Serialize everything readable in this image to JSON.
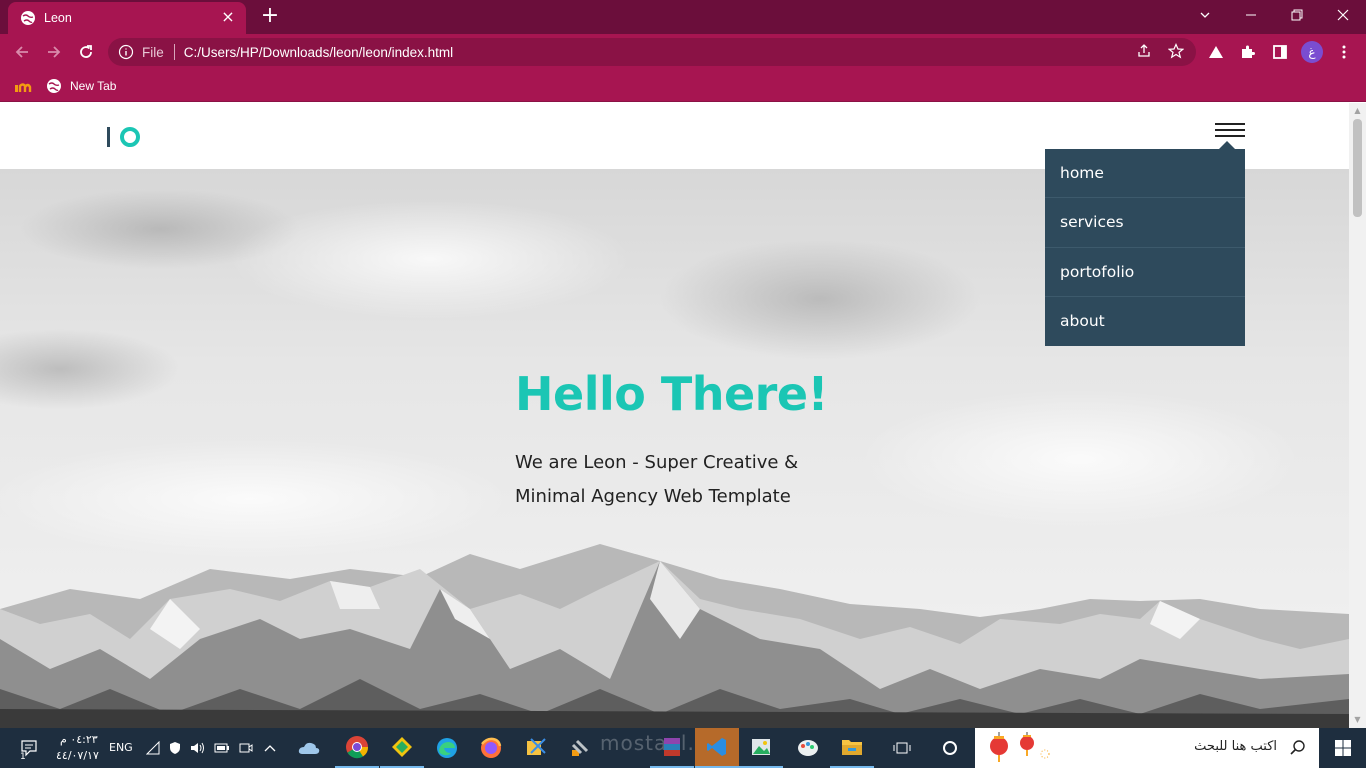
{
  "browser": {
    "tab_title": "Leon",
    "url_scheme": "File",
    "url_path": "C:/Users/HP/Downloads/leon/leon/index.html",
    "bookmarks": [
      {
        "label": "New Tab"
      }
    ],
    "profile_initial": "غ",
    "colors": {
      "tabbar": "#6b0e3b",
      "toolbar": "#a71551"
    }
  },
  "site": {
    "nav": {
      "items": [
        {
          "label": "home"
        },
        {
          "label": "services"
        },
        {
          "label": "portofolio"
        },
        {
          "label": "about"
        }
      ]
    },
    "hero": {
      "title": "Hello There!",
      "subtitle": "We are Leon - Super Creative & Minimal Agency Web Template"
    },
    "colors": {
      "accent": "#1bc6b4",
      "menu_bg": "#2e4a5c"
    }
  },
  "taskbar": {
    "search_placeholder": "اكتب هنا للبحث",
    "language": "ENG",
    "time": "٠٤:٢٣ م",
    "date": "٤٤/٠٧/١٧",
    "notification_count": "1",
    "watermark": "mostaql.com"
  }
}
